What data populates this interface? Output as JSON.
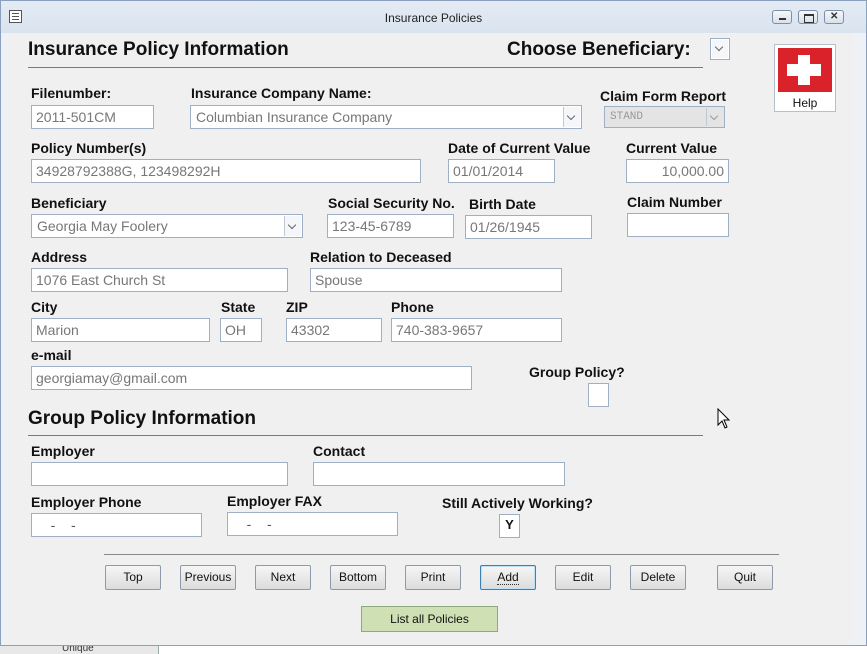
{
  "window": {
    "title": "Insurance Policies"
  },
  "header": {
    "title": "Insurance Policy Information",
    "choose_beneficiary": "Choose Beneficiary:"
  },
  "help": {
    "label": "Help"
  },
  "form": {
    "filenumber": {
      "label": "Filenumber:",
      "value": "2011-501CM"
    },
    "company": {
      "label": "Insurance Company Name:",
      "value": "Columbian Insurance Company"
    },
    "claim_form": {
      "label": "Claim Form Report",
      "value": "STAND"
    },
    "policy_numbers": {
      "label": "Policy Number(s)",
      "value": "34928792388G, 123498292H"
    },
    "date_current": {
      "label": "Date of Current Value",
      "value": "01/01/2014"
    },
    "current_value": {
      "label": "Current Value",
      "value": "10,000.00"
    },
    "beneficiary": {
      "label": "Beneficiary",
      "value": "Georgia May Foolery"
    },
    "ssn": {
      "label": "Social Security No.",
      "value": "123-45-6789"
    },
    "birth_date": {
      "label": "Birth Date",
      "value": "01/26/1945"
    },
    "claim_number": {
      "label": "Claim Number",
      "value": ""
    },
    "address": {
      "label": "Address",
      "value": "1076 East Church St"
    },
    "relation": {
      "label": "Relation to Deceased",
      "value": "Spouse"
    },
    "city": {
      "label": "City",
      "value": "Marion"
    },
    "state": {
      "label": "State",
      "value": "OH"
    },
    "zip": {
      "label": "ZIP",
      "value": "43302"
    },
    "phone": {
      "label": "Phone",
      "value": "740-383-9657"
    },
    "email": {
      "label": "e-mail",
      "value": "georgiamay@gmail.com"
    },
    "group_policy": {
      "label": "Group Policy?",
      "value": ""
    }
  },
  "group": {
    "title": "Group Policy Information",
    "employer": {
      "label": "Employer",
      "value": ""
    },
    "contact": {
      "label": "Contact",
      "value": ""
    },
    "employer_phone": {
      "label": "Employer Phone",
      "value": "   -   -"
    },
    "employer_fax": {
      "label": "Employer FAX",
      "value": "   -   -"
    },
    "still_working": {
      "label": "Still Actively Working?",
      "value": "Y"
    }
  },
  "nav": {
    "top": "Top",
    "previous": "Previous",
    "next": "Next",
    "bottom": "Bottom",
    "print": "Print",
    "add": "Add",
    "edit": "Edit",
    "delete": "Delete",
    "quit": "Quit",
    "list_all": "List all Policies"
  },
  "background_snippet": "Unique"
}
